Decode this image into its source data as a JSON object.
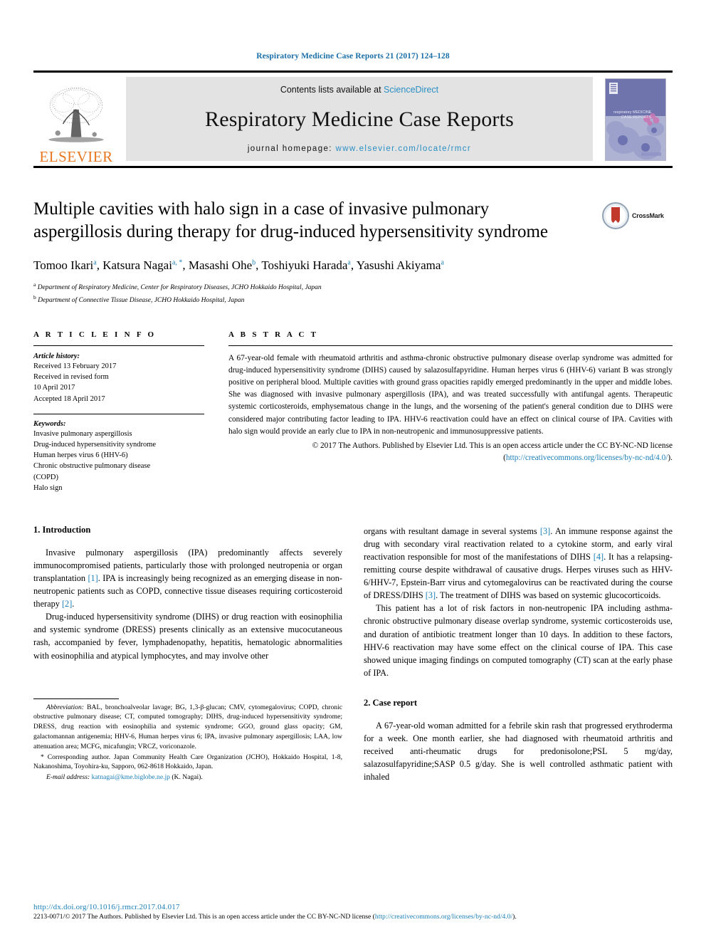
{
  "running_head": "Respiratory Medicine Case Reports 21 (2017) 124–128",
  "masthead": {
    "publisher_name": "ELSEVIER",
    "contents_prefix": "Contents lists available at ",
    "contents_link": "ScienceDirect",
    "journal_name": "Respiratory Medicine Case Reports",
    "homepage_prefix": "journal homepage: ",
    "homepage_url": "www.elsevier.com/locate/rmcr",
    "cover_line1": "respiratory MEDICINE",
    "cover_line2": "CASE REPORTS"
  },
  "title": "Multiple cavities with halo sign in a case of invasive pulmonary aspergillosis during therapy for drug-induced hypersensitivity syndrome",
  "crossmark_label": "CrossMark",
  "authors": [
    {
      "name": "Tomoo Ikari",
      "sup": "a",
      "sep": ", "
    },
    {
      "name": "Katsura Nagai",
      "sup": "a, *",
      "sep": ", "
    },
    {
      "name": "Masashi Ohe",
      "sup": "b",
      "sep": ", "
    },
    {
      "name": "Toshiyuki Harada",
      "sup": "a",
      "sep": ", "
    },
    {
      "name": "Yasushi Akiyama",
      "sup": "a",
      "sep": ""
    }
  ],
  "affiliations": [
    {
      "sup": "a",
      "text": "Department of Respiratory Medicine, Center for Respiratory Diseases, JCHO Hokkaido Hospital, Japan"
    },
    {
      "sup": "b",
      "text": "Department of Connective Tissue Disease, JCHO Hokkaido Hospital, Japan"
    }
  ],
  "article_info": {
    "heading": "A R T I C L E    I N F O",
    "history_label": "Article history:",
    "history": [
      "Received 13 February 2017",
      "Received in revised form",
      "10 April 2017",
      "Accepted 18 April 2017"
    ],
    "keywords_label": "Keywords:",
    "keywords": [
      "Invasive pulmonary aspergillosis",
      "Drug-induced hypersensitivity syndrome",
      "Human herpes virus 6 (HHV-6)",
      "Chronic obstructive pulmonary disease",
      "(COPD)",
      "Halo sign"
    ]
  },
  "abstract": {
    "heading": "A B S T R A C T",
    "body": "A 67-year-old female with rheumatoid arthritis and asthma-chronic obstructive pulmonary disease overlap syndrome was admitted for drug-induced hypersensitivity syndrome (DIHS) caused by salazosulfapyridine. Human herpes virus 6 (HHV-6) variant B was strongly positive on peripheral blood. Multiple cavities with ground grass opacities rapidly emerged predominantly in the upper and middle lobes. She was diagnosed with invasive pulmonary aspergillosis (IPA), and was treated successfully with antifungal agents. Therapeutic systemic corticosteroids, emphysematous change in the lungs, and the worsening of the patient's general condition due to DIHS were considered major contributing factor leading to IPA. HHV-6 reactivation could have an effect on clinical course of IPA. Cavities with halo sign would provide an early clue to IPA in non-neutropenic and immunosuppressive patients.",
    "copyright_pre": "© 2017 The Authors. Published by Elsevier Ltd. This is an open access article under the CC BY-NC-ND license (",
    "copyright_link": "http://creativecommons.org/licenses/by-nc-nd/4.0/",
    "copyright_post": ")."
  },
  "sections": {
    "introduction_title": "1. Introduction",
    "intro_p1": "Invasive pulmonary aspergillosis (IPA) predominantly affects severely immunocompromised patients, particularly those with prolonged neutropenia or organ transplantation [1]. IPA is increasingly being recognized as an emerging disease in non-neutropenic patients such as COPD, connective tissue diseases requiring corticosteroid therapy [2].",
    "intro_p1_parts": {
      "a": "Invasive pulmonary aspergillosis (IPA) predominantly affects severely immunocompromised patients, particularly those with prolonged neutropenia or organ transplantation ",
      "ref1": "[1]",
      "b": ". IPA is increasingly being recognized as an emerging disease in non-neutropenic patients such as COPD, connective tissue diseases requiring corticosteroid therapy ",
      "ref2": "[2]",
      "c": "."
    },
    "intro_p2": "Drug-induced hypersensitivity syndrome (DIHS) or drug reaction with eosinophilia and systemic syndrome (DRESS) presents clinically as an extensive mucocutaneous rash, accompanied by fever, lymphadenopathy, hepatitis, hematologic abnormalities with eosinophilia and atypical lymphocytes, and may involve other",
    "intro_p3_parts": {
      "a": "organs with resultant damage in several systems ",
      "ref3": "[3]",
      "b": ". An immune response against the drug with secondary viral reactivation related to a cytokine storm, and early viral reactivation responsible for most of the manifestations of DIHS ",
      "ref4": "[4]",
      "c": ". It has a relapsing-remitting course despite withdrawal of causative drugs. Herpes viruses such as HHV-6/HHV-7, Epstein-Barr virus and cytomegalovirus can be reactivated during the course of DRESS/DIHS ",
      "ref5": "[3]",
      "d": ". The treatment of DIHS was based on systemic glucocorticoids."
    },
    "intro_p4": "This patient has a lot of risk factors in non-neutropenic IPA including asthma-chronic obstructive pulmonary disease overlap syndrome, systemic corticosteroids use, and duration of antibiotic treatment longer than 10 days. In addition to these factors, HHV-6 reactivation may have some effect on the clinical course of IPA. This case showed unique imaging findings on computed tomography (CT) scan at the early phase of IPA.",
    "case_report_title": "2. Case report",
    "case_p1": "A 67-year-old woman admitted for a febrile skin rash that progressed erythroderma for a week. One month earlier, she had diagnosed with rheumatoid arthritis and received anti-rheumatic drugs for predonisolone;PSL 5 mg/day, salazosulfapyridine;SASP 0.5 g/day. She is well controlled asthmatic patient with inhaled"
  },
  "footnotes": {
    "abbrev_label": "Abbreviation:",
    "abbrev_text": " BAL, bronchoalveolar lavage; BG, 1,3-β-glucan; CMV, cytomegalovirus; COPD, chronic obstructive pulmonary disease; CT, computed tomography; DIHS, drug-induced hypersensitivity syndrome; DRESS, drug reaction with eosinophilia and systemic syndrome; GGO, ground glass opacity; GM, galactomannan antigenemia; HHV-6, Human herpes virus 6; IPA, invasive pulmonary aspergillosis; LAA, low attenuation area; MCFG, micafungin; VRCZ, voriconazole.",
    "corresponding": "* Corresponding author. Japan Community Health Care Organization (JCHO), Hokkaido Hospital, 1-8, Nakanoshima, Toyohira-ku, Sapporo, 062-8618 Hokkaido, Japan.",
    "email_label": "E-mail address:",
    "email": "katnagai@kme.biglobe.ne.jp",
    "email_suffix": " (K. Nagai)."
  },
  "page_footer": {
    "doi": "http://dx.doi.org/10.1016/j.rmcr.2017.04.017",
    "issn_copy_pre": "2213-0071/© 2017 The Authors. Published by Elsevier Ltd. This is an open access article under the CC BY-NC-ND license (",
    "issn_copy_link": "http://creativecommons.org/licenses/by-nc-nd/4.0/",
    "issn_copy_post": ")."
  },
  "colors": {
    "link": "#1a7fb8",
    "running_head": "#1a6fa8",
    "elsevier_orange": "#E87722",
    "band_gray": "#e3e3e3",
    "cover_purple": "#6f74ad"
  }
}
